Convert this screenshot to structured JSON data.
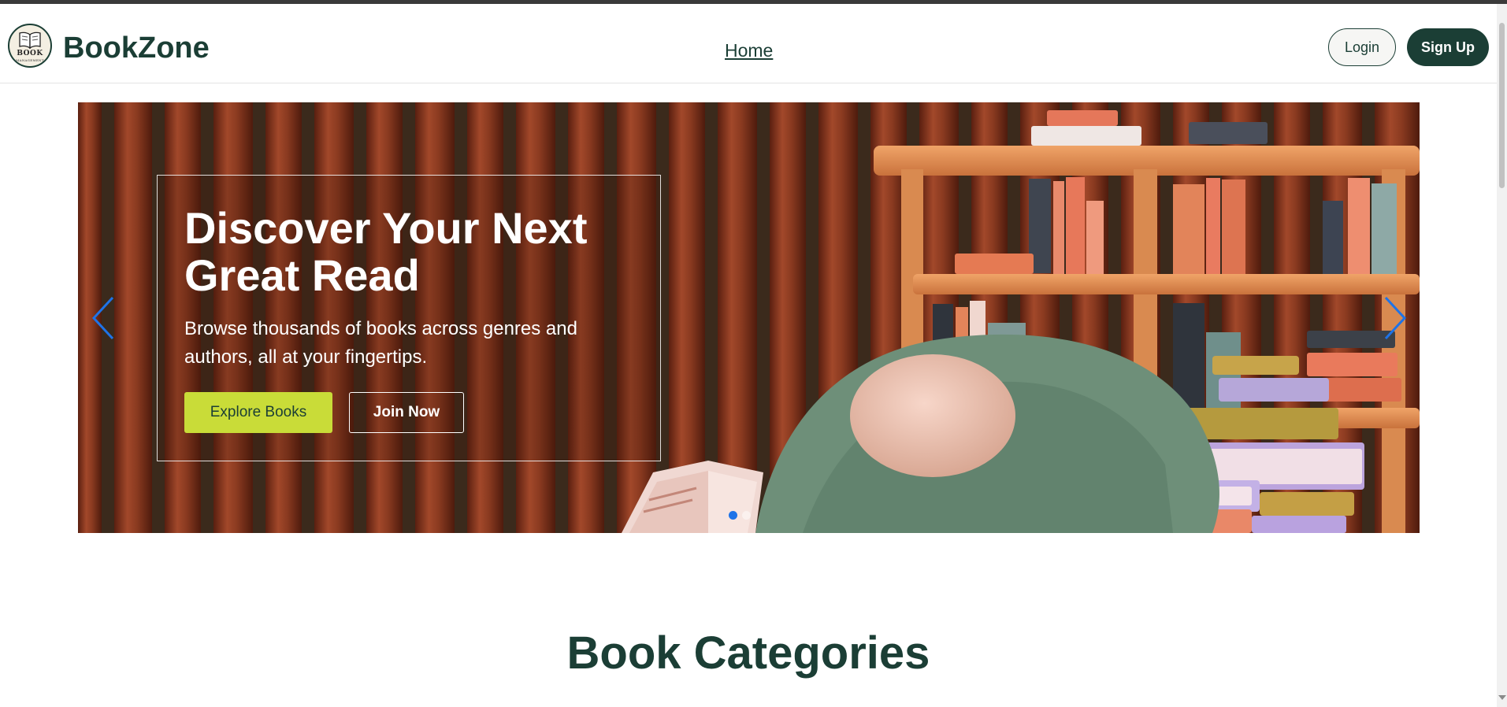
{
  "brand": {
    "name": "BookZone",
    "logo_line1": "BOOK",
    "logo_line2": "MANAGEMENT",
    "logo_icon": "open-book-icon"
  },
  "nav": {
    "links": [
      {
        "label": "Home"
      }
    ],
    "login_label": "Login",
    "signup_label": "Sign Up"
  },
  "hero": {
    "title": "Discover Your Next Great Read",
    "subtitle": "Browse thousands of books across genres and authors, all at your fingertips.",
    "primary_cta": "Explore Books",
    "secondary_cta": "Join Now",
    "prev_icon": "chevron-left-icon",
    "next_icon": "chevron-right-icon",
    "slide_count": 2,
    "active_slide": 1
  },
  "sections": {
    "categories_title": "Book Categories"
  },
  "colors": {
    "brand_dark_green": "#1b3e35",
    "accent_lime": "#c9dc38",
    "carousel_indicator_active": "#1e73e8"
  }
}
